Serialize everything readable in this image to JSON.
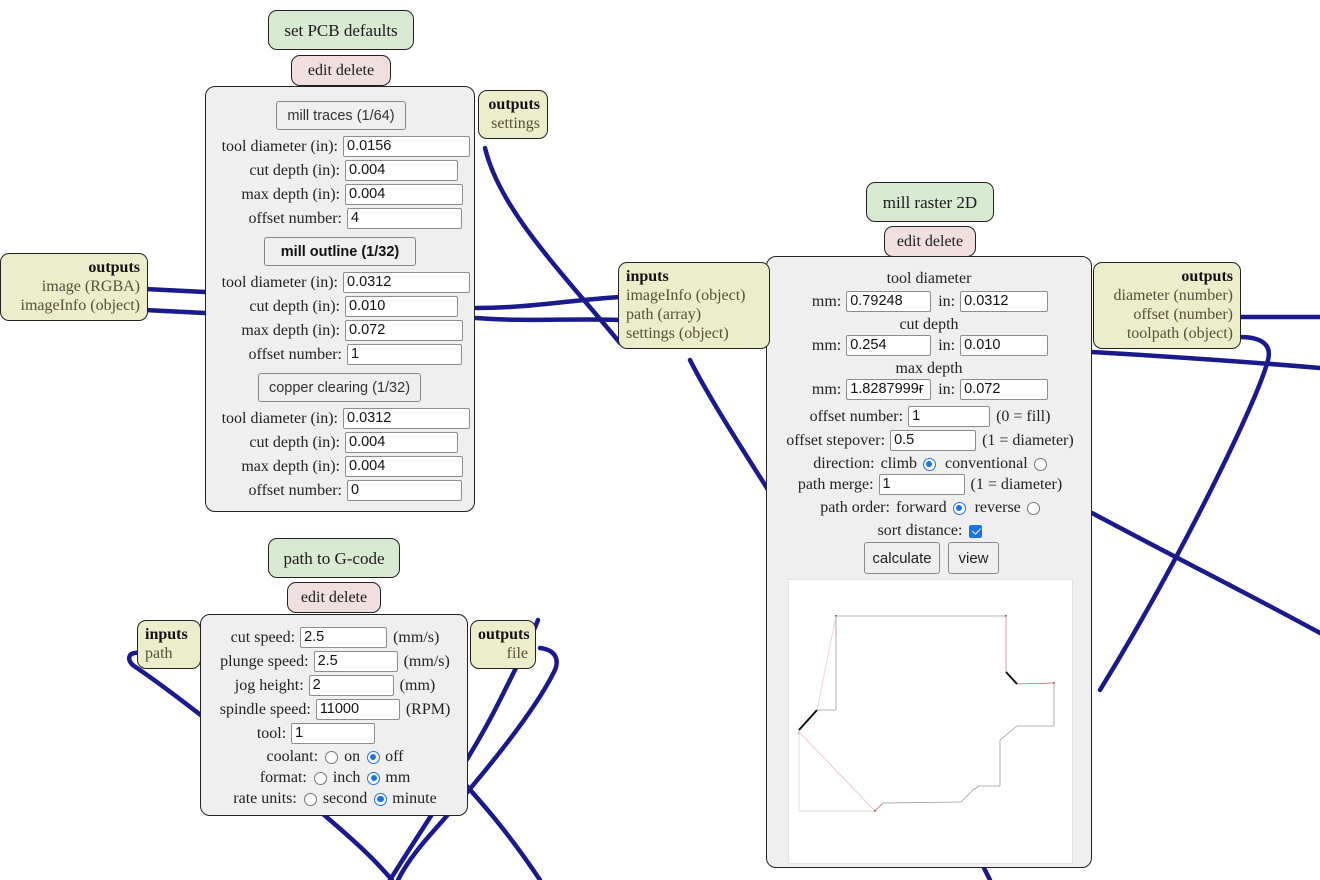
{
  "nodes": {
    "set_pcb_defaults": {
      "title": "set PCB defaults",
      "edit_delete": "edit delete",
      "outputs_port": {
        "heading": "outputs",
        "items": [
          "settings"
        ]
      },
      "inputs_port": {
        "heading": "outputs",
        "items": [
          "image (RGBA)",
          "imageInfo (object)"
        ]
      },
      "sections": [
        {
          "label": "mill traces (1/64)",
          "bold": false,
          "fields": [
            {
              "label": "tool diameter (in):",
              "value": "0.0156"
            },
            {
              "label": "cut depth (in):",
              "value": "0.004"
            },
            {
              "label": "max depth (in):",
              "value": "0.004"
            },
            {
              "label": "offset number:",
              "value": "4"
            }
          ]
        },
        {
          "label": "mill outline (1/32)",
          "bold": true,
          "fields": [
            {
              "label": "tool diameter (in):",
              "value": "0.0312"
            },
            {
              "label": "cut depth (in):",
              "value": "0.010"
            },
            {
              "label": "max depth (in):",
              "value": "0.072"
            },
            {
              "label": "offset number:",
              "value": "1"
            }
          ]
        },
        {
          "label": "copper clearing (1/32)",
          "bold": false,
          "fields": [
            {
              "label": "tool diameter (in):",
              "value": "0.0312"
            },
            {
              "label": "cut depth (in):",
              "value": "0.004"
            },
            {
              "label": "max depth (in):",
              "value": "0.004"
            },
            {
              "label": "offset number:",
              "value": "0"
            }
          ]
        }
      ]
    },
    "mill_raster_2d": {
      "title": "mill raster 2D",
      "edit_delete": "edit delete",
      "inputs_port": {
        "heading": "inputs",
        "items": [
          "imageInfo (object)",
          "path (array)",
          "settings (object)"
        ]
      },
      "outputs_port": {
        "heading": "outputs",
        "items": [
          "diameter (number)",
          "offset (number)",
          "toolpath (object)"
        ]
      },
      "groups": [
        {
          "title": "tool diameter",
          "mm_label": "mm:",
          "mm_value": "0.79248",
          "in_label": "in:",
          "in_value": "0.0312"
        },
        {
          "title": "cut depth",
          "mm_label": "mm:",
          "mm_value": "0.254",
          "in_label": "in:",
          "in_value": "0.010"
        },
        {
          "title": "max depth",
          "mm_label": "mm:",
          "mm_value": "1.8287999ғ",
          "in_label": "in:",
          "in_value": "0.072"
        }
      ],
      "offset_number": {
        "label": "offset number:",
        "value": "1",
        "hint": "(0 = fill)"
      },
      "offset_stepover": {
        "label": "offset stepover:",
        "value": "0.5",
        "hint": "(1 = diameter)"
      },
      "direction": {
        "label": "direction:",
        "opt1": "climb",
        "opt1_selected": true,
        "opt2": "conventional",
        "opt2_selected": false
      },
      "path_merge": {
        "label": "path merge:",
        "value": "1",
        "hint": "(1 = diameter)"
      },
      "path_order": {
        "label": "path order:",
        "opt1": "forward",
        "opt1_selected": true,
        "opt2": "reverse",
        "opt2_selected": false
      },
      "sort_distance": {
        "label": "sort distance:",
        "checked": true
      },
      "buttons": {
        "calculate": "calculate",
        "view": "view"
      }
    },
    "path_to_gcode": {
      "title": "path to G-code",
      "edit_delete": "edit delete",
      "inputs_port": {
        "heading": "inputs",
        "items": [
          "path"
        ]
      },
      "outputs_port": {
        "heading": "outputs",
        "items": [
          "file"
        ]
      },
      "fields": [
        {
          "label": "cut speed:",
          "value": "2.5",
          "unit": "(mm/s)"
        },
        {
          "label": "plunge speed:",
          "value": "2.5",
          "unit": "(mm/s)"
        },
        {
          "label": "jog height:",
          "value": "2",
          "unit": "(mm)"
        },
        {
          "label": "spindle speed:",
          "value": "11000",
          "unit": "(RPM)"
        },
        {
          "label": "tool:",
          "value": "1",
          "unit": ""
        }
      ],
      "coolant": {
        "label": "coolant:",
        "opt1": "on",
        "opt1_selected": false,
        "opt2": "off",
        "opt2_selected": true
      },
      "format": {
        "label": "format:",
        "opt1": "inch",
        "opt1_selected": false,
        "opt2": "mm",
        "opt2_selected": true
      },
      "rate_units": {
        "label": "rate units:",
        "opt1": "second",
        "opt1_selected": false,
        "opt2": "minute",
        "opt2_selected": true
      }
    }
  },
  "colors": {
    "title_bg": "#d9ead3",
    "editdel_bg": "#f1dede",
    "port_bg": "#ecedcb",
    "panel_bg": "#efefef",
    "wire": "#1a1a8c",
    "accent": "#1a73e8"
  }
}
